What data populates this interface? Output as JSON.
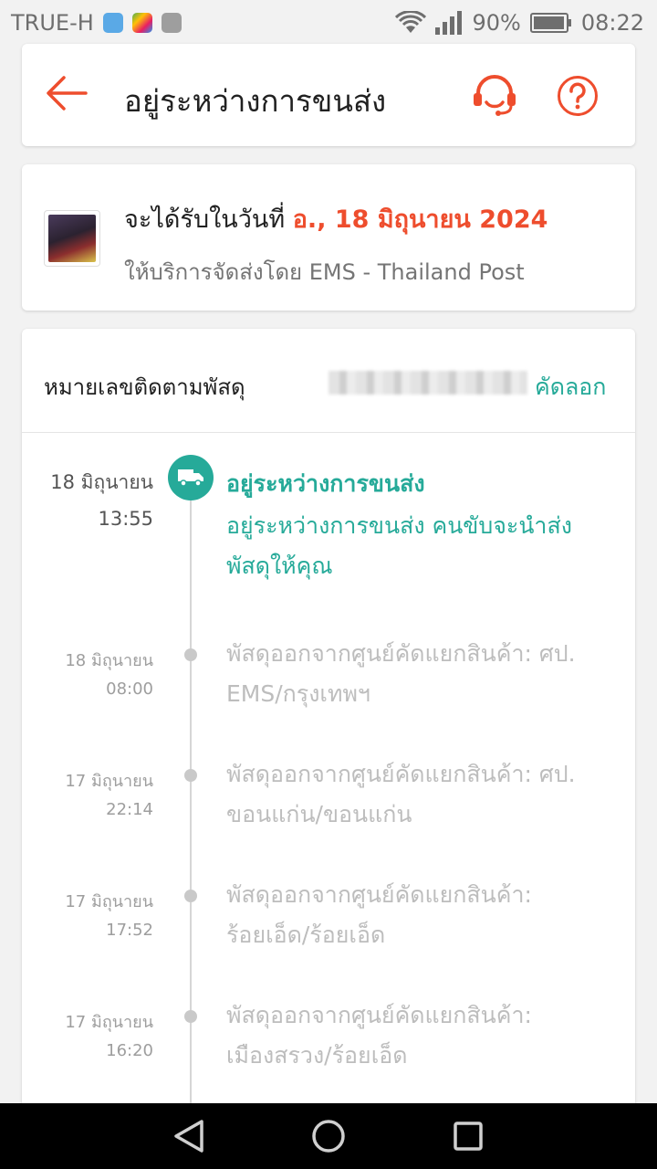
{
  "status_bar": {
    "carrier": "TRUE-H",
    "battery": "90%",
    "time": "08:22"
  },
  "header": {
    "title": "อยู่ระหว่างการขนส่ง"
  },
  "delivery": {
    "prefix": "จะได้รับในวันที่ ",
    "date": "อ., 18 มิถุนายน 2024",
    "provider": "ให้บริการจัดส่งโดย EMS - Thailand Post"
  },
  "tracking": {
    "label": "หมายเลขติดตามพัสดุ",
    "copy_label": "คัดลอก"
  },
  "current_event": {
    "date": "18 มิถุนายน",
    "time": "13:55",
    "title": "อยู่ระหว่างการขนส่ง",
    "description": "อยู่ระหว่างการขนส่ง คนขับจะนำส่งพัสดุให้คุณ"
  },
  "events": [
    {
      "date": "18 มิถุนายน",
      "time": "08:00",
      "text": "พัสดุออกจากศูนย์คัดแยกสินค้า: ศป. EMS/กรุงเทพฯ"
    },
    {
      "date": "17 มิถุนายน",
      "time": "22:14",
      "text": "พัสดุออกจากศูนย์คัดแยกสินค้า: ศป. ขอนแก่น/ขอนแก่น"
    },
    {
      "date": "17 มิถุนายน",
      "time": "17:52",
      "text": "พัสดุออกจากศูนย์คัดแยกสินค้า: ร้อยเอ็ด/ร้อยเอ็ด"
    },
    {
      "date": "17 มิถุนายน",
      "time": "16:20",
      "text": "พัสดุออกจากศูนย์คัดแยกสินค้า: เมืองสรวง/ร้อยเอ็ด"
    }
  ],
  "colors": {
    "accent": "#ee4d2d",
    "teal": "#26aa99"
  },
  "icons": {
    "back": "back-arrow-icon",
    "support": "headset-icon",
    "help": "help-icon",
    "truck": "truck-icon"
  }
}
